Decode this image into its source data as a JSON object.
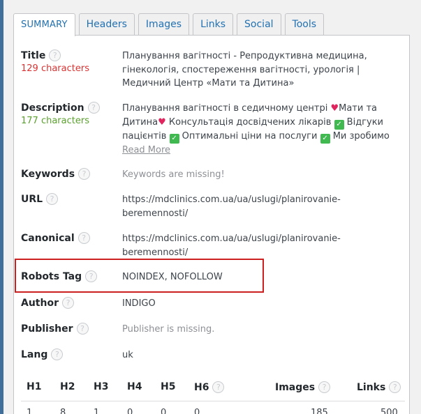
{
  "tabs": [
    {
      "label": "SUMMARY",
      "active": true
    },
    {
      "label": "Headers",
      "active": false
    },
    {
      "label": "Images",
      "active": false
    },
    {
      "label": "Links",
      "active": false
    },
    {
      "label": "Social",
      "active": false
    },
    {
      "label": "Tools",
      "active": false
    }
  ],
  "help_glyph": "?",
  "summary": {
    "title": {
      "label": "Title",
      "count": "129 characters",
      "value": "Планування вагітності - Репродуктивна медицина, гінекологія, спостереження вагітності, урологія | Медичний Центр «Мати та Дитина»"
    },
    "description": {
      "label": "Description",
      "count": "177 characters",
      "part1": "Планування вагітності в седичному центрі ",
      "part2": "Мати та Дитина",
      "part3": " Консультація досвідчених лікарів ",
      "part4": " Відгуки пацієнтів ",
      "part5": " Оптимальні ціни на послуги ",
      "part6": " Ми зробимо",
      "read_more": "Read More"
    },
    "keywords": {
      "label": "Keywords",
      "value": "Keywords are missing!"
    },
    "url": {
      "label": "URL",
      "value": "https://mdclinics.com.ua/ua/uslugi/planirovanie-beremennosti/"
    },
    "canonical": {
      "label": "Canonical",
      "value": "https://mdclinics.com.ua/ua/uslugi/planirovanie-beremennosti/"
    },
    "robots": {
      "label": "Robots Tag",
      "value": "NOINDEX, NOFOLLOW"
    },
    "author": {
      "label": "Author",
      "value": "INDIGO"
    },
    "publisher": {
      "label": "Publisher",
      "value": "Publisher is missing."
    },
    "lang": {
      "label": "Lang",
      "value": "uk"
    }
  },
  "stats": {
    "headers": [
      "H1",
      "H2",
      "H3",
      "H4",
      "H5",
      "H6",
      "Images",
      "Links"
    ],
    "values": [
      "1",
      "8",
      "1",
      "0",
      "0",
      "0",
      "185",
      "500"
    ]
  },
  "colors": {
    "accent": "#2271b1",
    "count_red": "#dc3232",
    "count_green": "#5aa02c",
    "highlight": "#cc1f1f"
  },
  "icons": {
    "help": "question-circle-icon",
    "heart": "heart-icon",
    "check": "check-box-icon"
  }
}
